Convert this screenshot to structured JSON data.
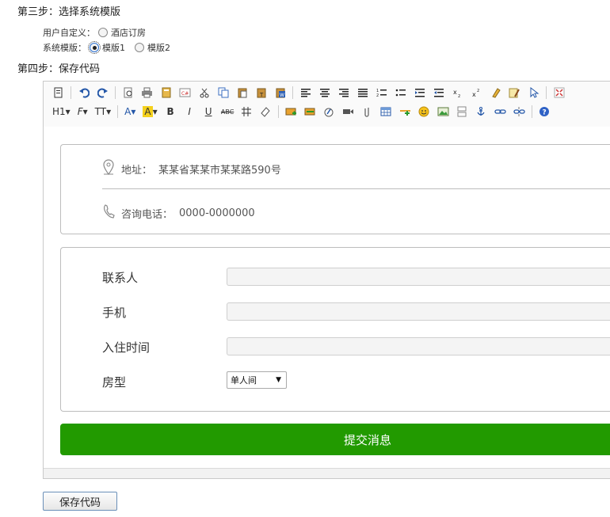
{
  "step3": {
    "title": "第三步：选择系统模版"
  },
  "options": {
    "custom_label": "用户自定义：",
    "custom_choice": "酒店订房",
    "system_label": "系统模版：",
    "system_choice_1": "模版1",
    "system_choice_2": "模版2",
    "selected": "模版1"
  },
  "step4": {
    "title": "第四步：保存代码"
  },
  "toolbar": {
    "heading_btn": "H1",
    "font_btn": "F",
    "size_btn": "TT",
    "bold": "B",
    "italic": "I",
    "underline": "U",
    "strike": "ABC",
    "help": "?"
  },
  "preview": {
    "address_label": "地址：",
    "address_value": "某某省某某市某某路590号",
    "phone_label": "咨询电话：",
    "phone_value": "0000-0000000",
    "form": {
      "contact_label": "联系人",
      "mobile_label": "手机",
      "checkin_label": "入住时间",
      "room_label": "房型",
      "room_selected": "单人间"
    },
    "submit_label": "提交消息"
  },
  "save_button": "保存代码",
  "colors": {
    "submit_bg": "#229a00",
    "accent": "#2a6fd0"
  }
}
